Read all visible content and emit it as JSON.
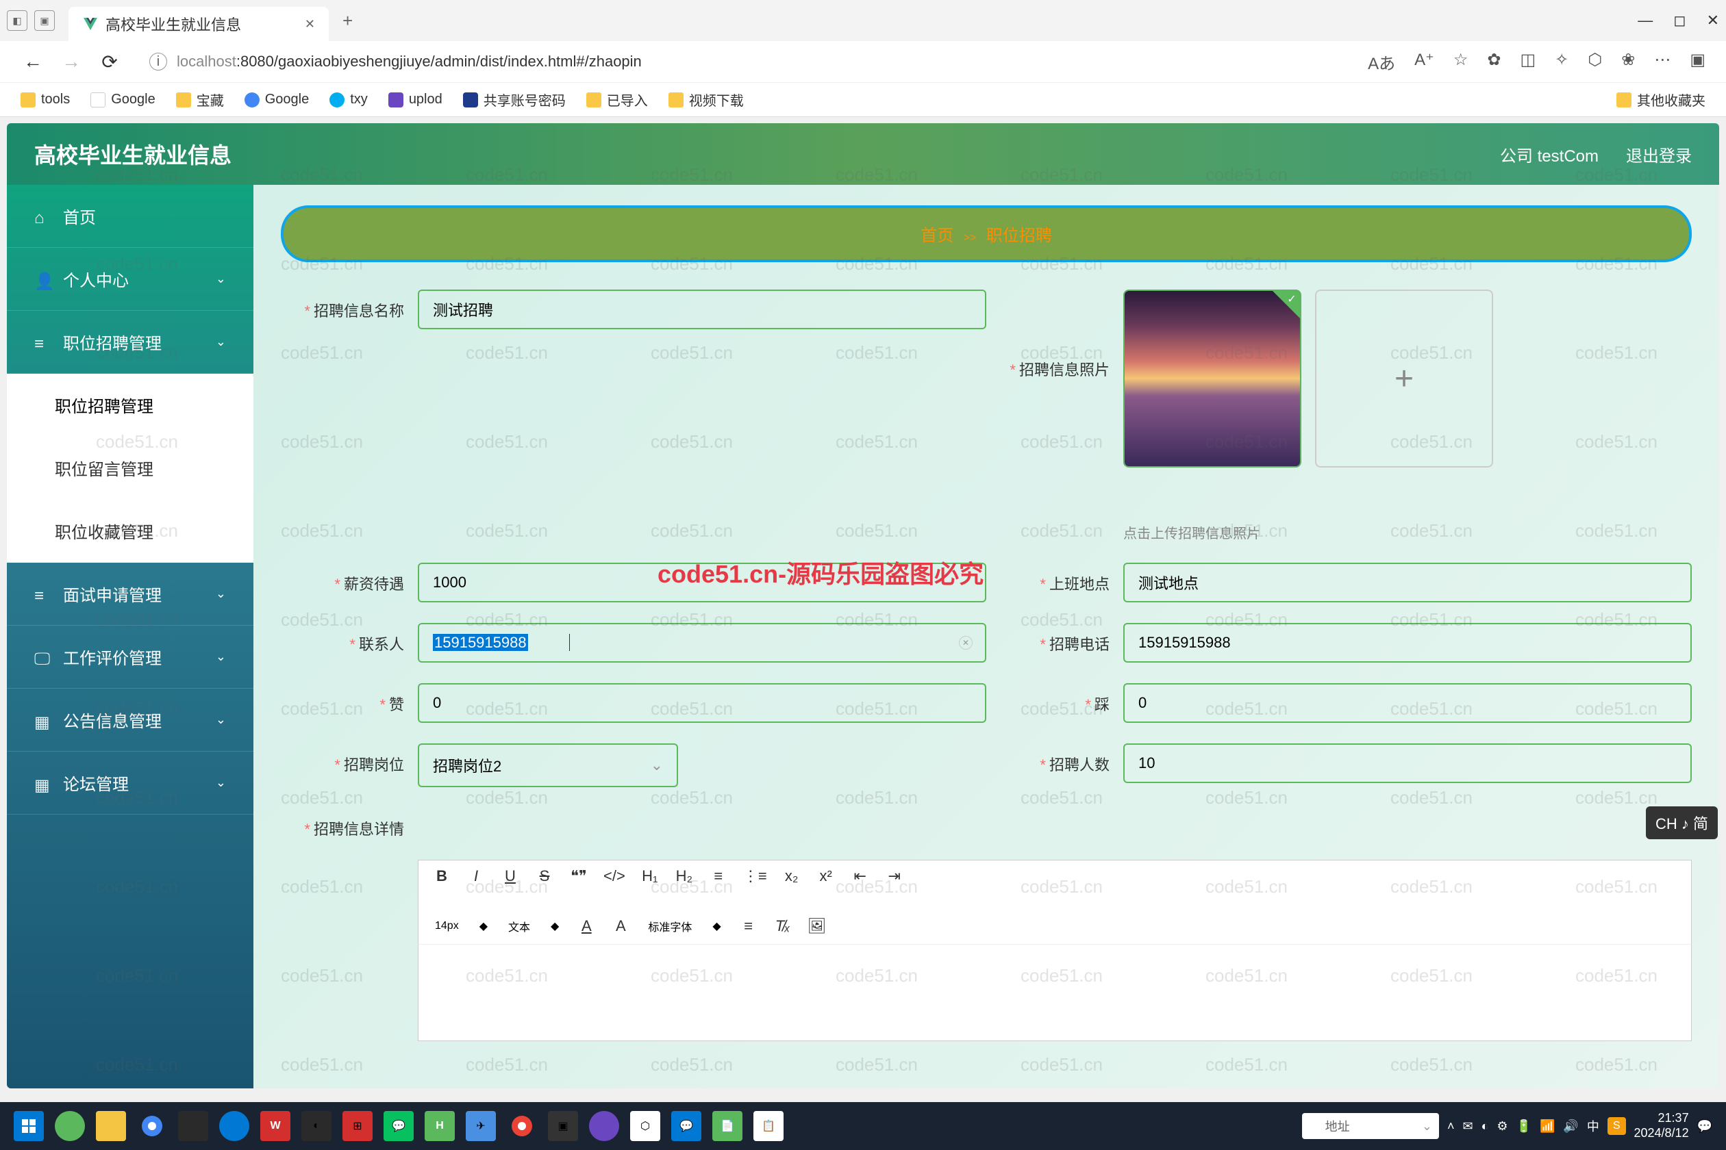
{
  "browser": {
    "tab_title": "高校毕业生就业信息",
    "url_host": "localhost",
    "url_path": ":8080/gaoxiaobiyeshengjiuye/admin/dist/index.html#/zhaopin",
    "aa_icon": "Aあ",
    "bookmarks": [
      "tools",
      "Google",
      "宝藏",
      "Google",
      "txy",
      "uplod",
      "共享账号密码",
      "已导入",
      "视频下载"
    ],
    "other_bookmarks": "其他收藏夹"
  },
  "app": {
    "title": "高校毕业生就业信息",
    "user_label": "公司 testCom",
    "logout": "退出登录"
  },
  "sidebar": {
    "items": [
      {
        "label": "首页",
        "icon": "home-icon"
      },
      {
        "label": "个人中心",
        "icon": "user-icon",
        "expandable": true
      },
      {
        "label": "职位招聘管理",
        "icon": "list-icon",
        "expandable": true
      },
      {
        "label": "职位招聘管理",
        "sub": true,
        "active": true
      },
      {
        "label": "职位留言管理",
        "sub": true
      },
      {
        "label": "职位收藏管理",
        "sub": true
      },
      {
        "label": "面试申请管理",
        "icon": "menu-icon",
        "expandable": true
      },
      {
        "label": "工作评价管理",
        "icon": "monitor-icon",
        "expandable": true
      },
      {
        "label": "公告信息管理",
        "icon": "grid-icon",
        "expandable": true
      },
      {
        "label": "论坛管理",
        "icon": "grid-icon",
        "expandable": true
      }
    ]
  },
  "breadcrumb": {
    "home": "首页",
    "sep": ">>",
    "current": "职位招聘"
  },
  "form": {
    "name_label": "招聘信息名称",
    "name_value": "测试招聘",
    "photo_label": "招聘信息照片",
    "upload_hint": "点击上传招聘信息照片",
    "salary_label": "薪资待遇",
    "salary_value": "1000",
    "location_label": "上班地点",
    "location_value": "测试地点",
    "contact_label": "联系人",
    "contact_value": "15915915988",
    "phone_label": "招聘电话",
    "phone_value": "15915915988",
    "like_label": "赞",
    "like_value": "0",
    "dislike_label": "踩",
    "dislike_value": "0",
    "position_label": "招聘岗位",
    "position_value": "招聘岗位2",
    "count_label": "招聘人数",
    "count_value": "10",
    "detail_label": "招聘信息详情"
  },
  "editor": {
    "font_size": "14px",
    "block": "文本",
    "font_family": "标准字体"
  },
  "watermark": {
    "text": "code51.cn",
    "red": "code51.cn-源码乐园盗图必究"
  },
  "ime": {
    "badge": "CH ♪ 简",
    "lang": "中",
    "addr_label": "地址"
  },
  "clock": {
    "time": "21:37",
    "date": "2024/8/12"
  }
}
